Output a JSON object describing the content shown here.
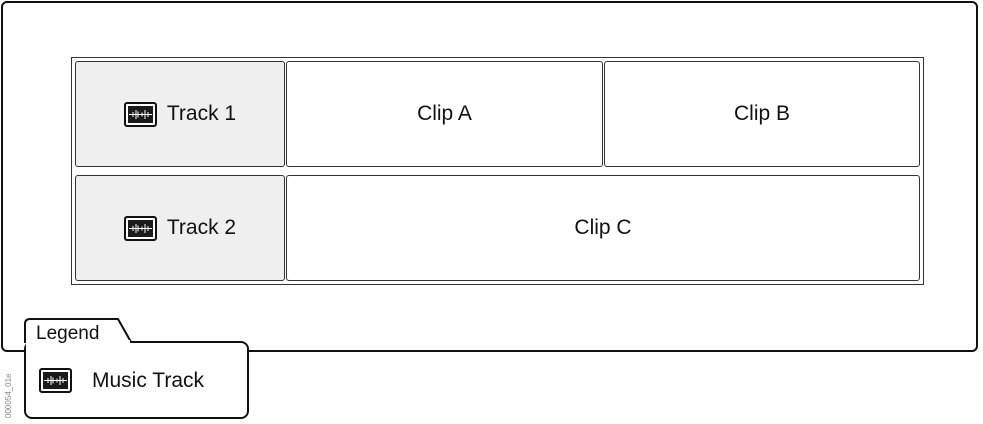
{
  "tracks": [
    {
      "label": "Track 1",
      "icon": "music-track-icon",
      "clips": [
        "Clip A",
        "Clip B"
      ]
    },
    {
      "label": "Track 2",
      "icon": "music-track-icon",
      "clips": [
        "Clip C"
      ]
    }
  ],
  "legend": {
    "title": "Legend",
    "items": [
      {
        "label": "Music Track",
        "icon": "music-track-icon"
      }
    ]
  },
  "image_code": "000054_01e",
  "colors": {
    "header_fill": "#efefef",
    "stroke": "#111111"
  }
}
